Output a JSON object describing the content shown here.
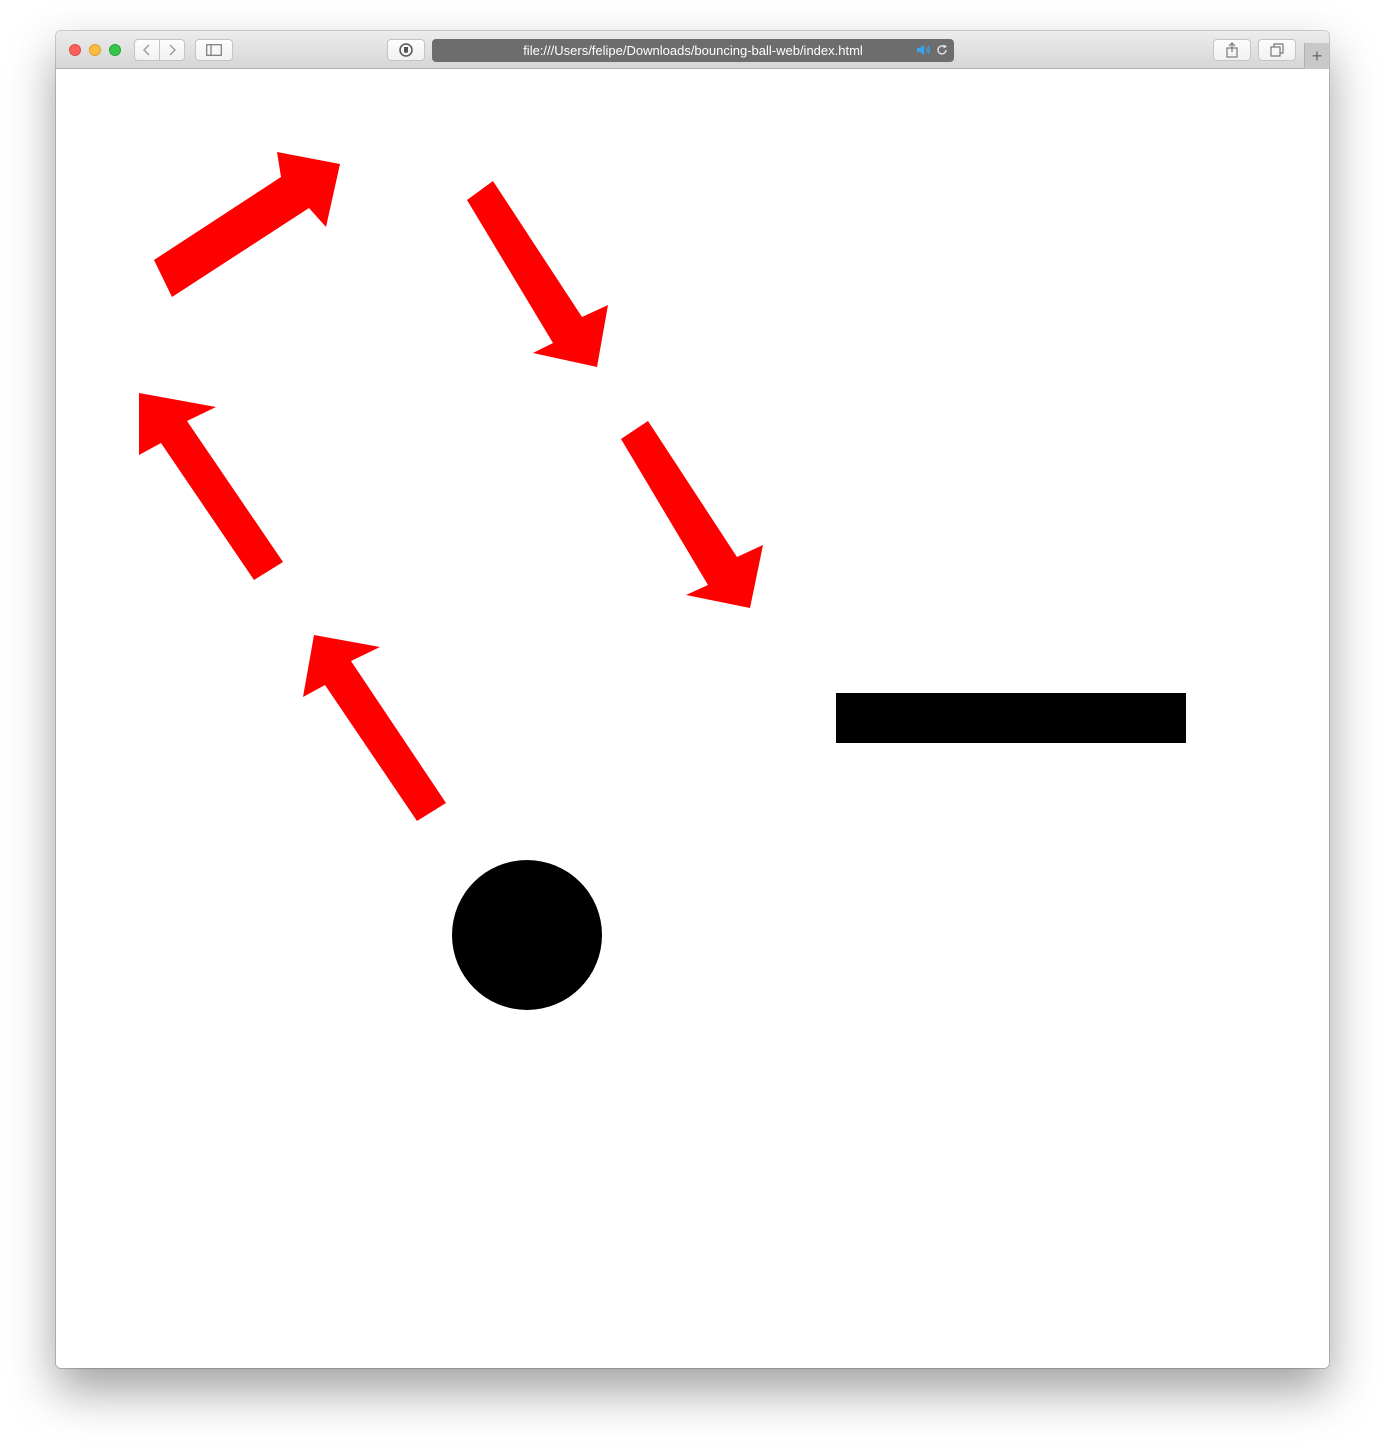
{
  "browser": {
    "url": "file:///Users/felipe/Downloads/bouncing-ball-web/index.html",
    "icons": {
      "back": "chevron-left-icon",
      "forward": "chevron-right-icon",
      "sidebar": "sidebar-icon",
      "privacy": "shield-icon",
      "audio": "speaker-icon",
      "reload": "reload-icon",
      "share": "share-icon",
      "tabs": "tabs-icon",
      "new_tab": "plus-icon"
    },
    "new_tab_label": "+"
  },
  "scene": {
    "arrow_color": "#ff0000",
    "ball_color": "#000000",
    "paddle_color": "#000000",
    "background": "#ffffff",
    "arrow_count": 5
  }
}
